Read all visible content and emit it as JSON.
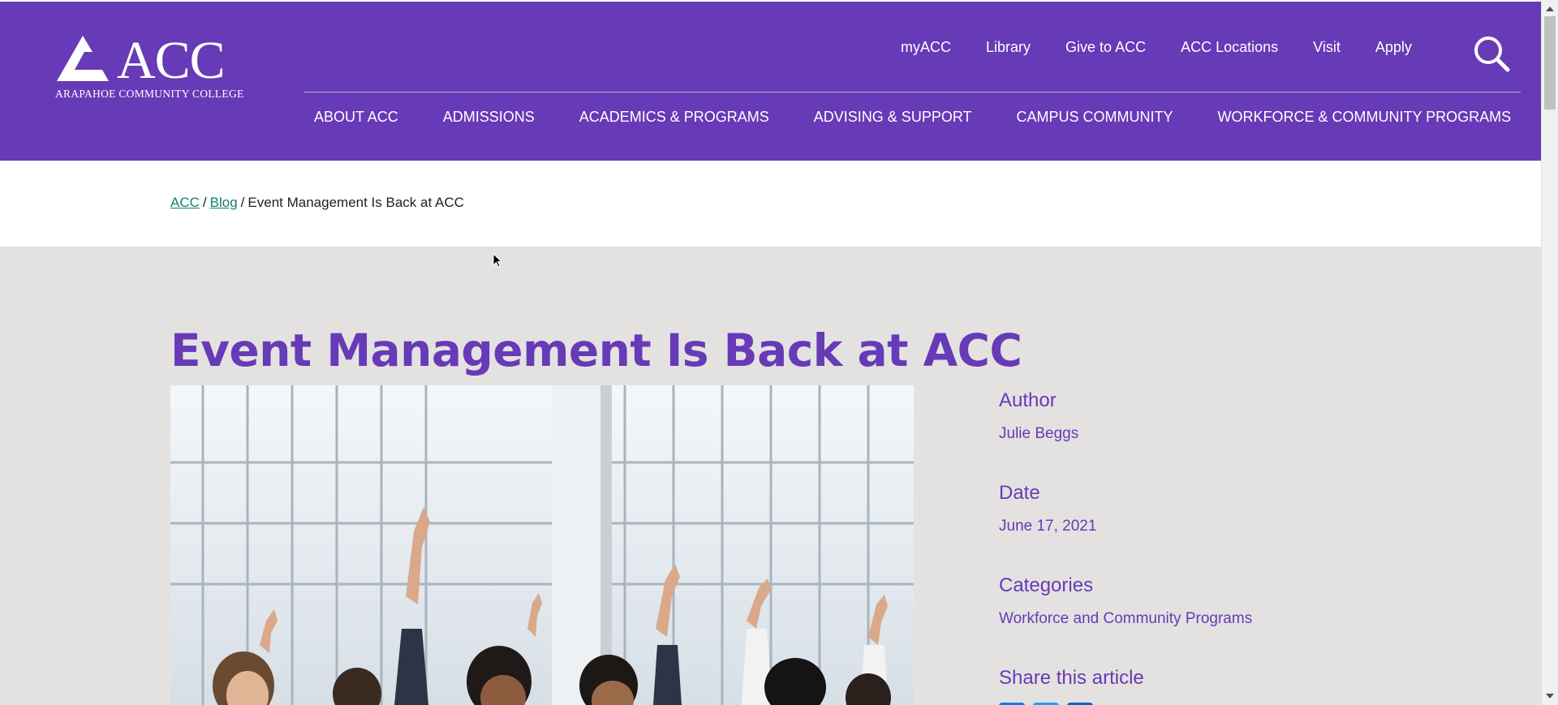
{
  "header": {
    "logo_text": "ACC",
    "logo_subtext": "ARAPAHOE COMMUNITY COLLEGE",
    "utility_nav": [
      "myACC",
      "Library",
      "Give to ACC",
      "ACC Locations",
      "Visit",
      "Apply"
    ],
    "main_nav": [
      "ABOUT ACC",
      "ADMISSIONS",
      "ACADEMICS & PROGRAMS",
      "ADVISING & SUPPORT",
      "CAMPUS COMMUNITY",
      "WORKFORCE & COMMUNITY PROGRAMS"
    ],
    "search_icon": "search-icon"
  },
  "breadcrumb": {
    "items": [
      "ACC",
      "Blog"
    ],
    "current": "Event Management Is Back at ACC",
    "separator": "/"
  },
  "article": {
    "title": "Event Management Is Back at ACC",
    "hero_image": "audience-raising-hands-photo"
  },
  "sidebar": {
    "author_label": "Author",
    "author": "Julie Beggs",
    "date_label": "Date",
    "date": "June 17, 2021",
    "categories_label": "Categories",
    "category": "Workforce and Community Programs",
    "share_label": "Share this article",
    "share_icons": [
      "facebook-icon",
      "twitter-icon",
      "linkedin-icon"
    ]
  },
  "colors": {
    "brand_purple": "#673ab7",
    "link_teal": "#14806e",
    "page_background": "#e4e2e1"
  }
}
